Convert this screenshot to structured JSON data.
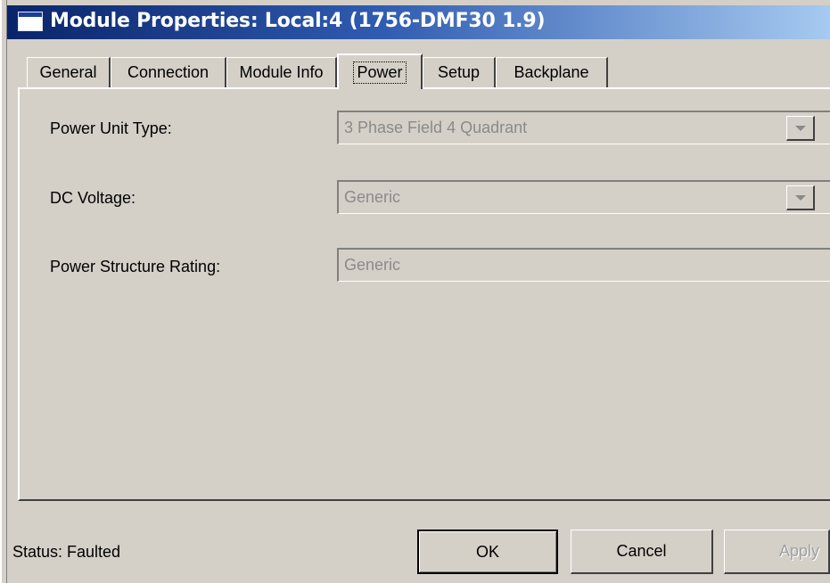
{
  "window": {
    "title": "Module Properties: Local:4 (1756-DMF30 1.9)",
    "icon": "window-icon"
  },
  "tabs": [
    {
      "label": "General",
      "active": false
    },
    {
      "label": "Connection",
      "active": false
    },
    {
      "label": "Module Info",
      "active": false
    },
    {
      "label": "Power",
      "active": true
    },
    {
      "label": "Setup",
      "active": false
    },
    {
      "label": "Backplane",
      "active": false
    }
  ],
  "fields": {
    "power_unit_type": {
      "label": "Power Unit Type:",
      "value": "3 Phase Field 4 Quadrant"
    },
    "dc_voltage": {
      "label": "DC Voltage:",
      "value": "Generic"
    },
    "power_structure_rating": {
      "label": "Power Structure Rating:",
      "value": "Generic"
    }
  },
  "status": {
    "text": "Status:  Faulted"
  },
  "buttons": {
    "ok": "OK",
    "cancel": "Cancel",
    "apply": "Apply"
  },
  "colors": {
    "face": "#d4d0c8",
    "title_start": "#0a246a",
    "title_end": "#a6caf0",
    "disabled_text": "#8a8a8a"
  }
}
